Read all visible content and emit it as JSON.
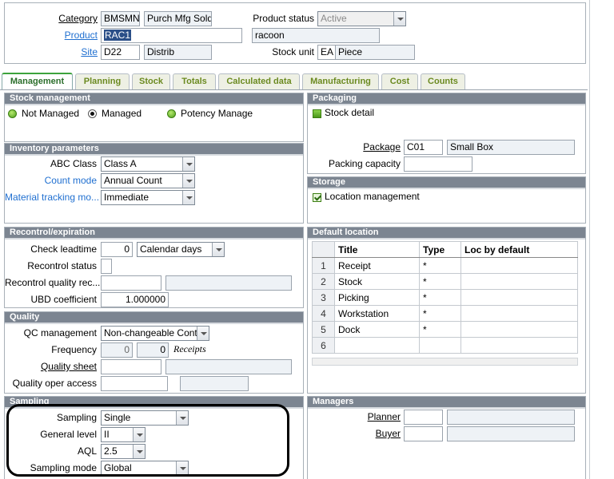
{
  "header": {
    "category": {
      "label": "Category",
      "code": "BMSMN",
      "desc": "Purch Mfg Sold"
    },
    "product": {
      "label": "Product",
      "code": "RAC1",
      "desc": "racoon"
    },
    "site": {
      "label": "Site",
      "code": "D22",
      "desc": "Distrib"
    },
    "product_status": {
      "label": "Product status",
      "value": "Active"
    },
    "stock_unit": {
      "label": "Stock unit",
      "code": "EA",
      "desc": "Piece"
    }
  },
  "tabs": [
    "Management",
    "Planning",
    "Stock",
    "Totals",
    "Calculated data",
    "Manufacturing",
    "Cost",
    "Counts"
  ],
  "stock_management": {
    "title": "Stock management",
    "options": [
      "Not Managed",
      "Managed",
      "Potency Manage"
    ]
  },
  "inventory": {
    "title": "Inventory parameters",
    "abc_label": "ABC Class",
    "abc_value": "Class A",
    "count_label": "Count mode",
    "count_value": "Annual Count",
    "tracking_label": "Material tracking mo...",
    "tracking_value": "Immediate"
  },
  "recontrol": {
    "title": "Recontrol/expiration",
    "leadtime_label": "Check leadtime",
    "leadtime_value": "0",
    "leadtime_unit": "Calendar days",
    "status_label": "Recontrol status",
    "quality_label": "Recontrol quality rec...",
    "ubd_label": "UBD coefficient",
    "ubd_value": "1.000000"
  },
  "quality": {
    "title": "Quality",
    "qc_label": "QC management",
    "qc_value": "Non-changeable Contro",
    "freq_label": "Frequency",
    "freq_a": "0",
    "freq_b": "0",
    "freq_unit": "Receipts",
    "sheet_label": "Quality sheet",
    "access_label": "Quality oper access"
  },
  "sampling": {
    "title": "Sampling",
    "sampling_label": "Sampling",
    "sampling_value": "Single",
    "level_label": "General level",
    "level_value": "II",
    "aql_label": "AQL",
    "aql_value": "2.5",
    "mode_label": "Sampling mode",
    "mode_value": "Global"
  },
  "packaging": {
    "title": "Packaging",
    "stock_detail": "Stock detail",
    "package_label": "Package",
    "package_code": "C01",
    "package_desc": "Small Box",
    "capacity_label": "Packing capacity"
  },
  "storage": {
    "title": "Storage",
    "location_mgmt": "Location management"
  },
  "default_location": {
    "title": "Default location",
    "columns": [
      "Title",
      "Type",
      "Loc by default"
    ],
    "rows": [
      {
        "n": "1",
        "title": "Receipt",
        "type": "*"
      },
      {
        "n": "2",
        "title": "Stock",
        "type": "*"
      },
      {
        "n": "3",
        "title": "Picking",
        "type": "*"
      },
      {
        "n": "4",
        "title": "Workstation",
        "type": "*"
      },
      {
        "n": "5",
        "title": "Dock",
        "type": "*"
      },
      {
        "n": "6",
        "title": "",
        "type": ""
      }
    ]
  },
  "managers": {
    "title": "Managers",
    "planner_label": "Planner",
    "buyer_label": "Buyer"
  }
}
